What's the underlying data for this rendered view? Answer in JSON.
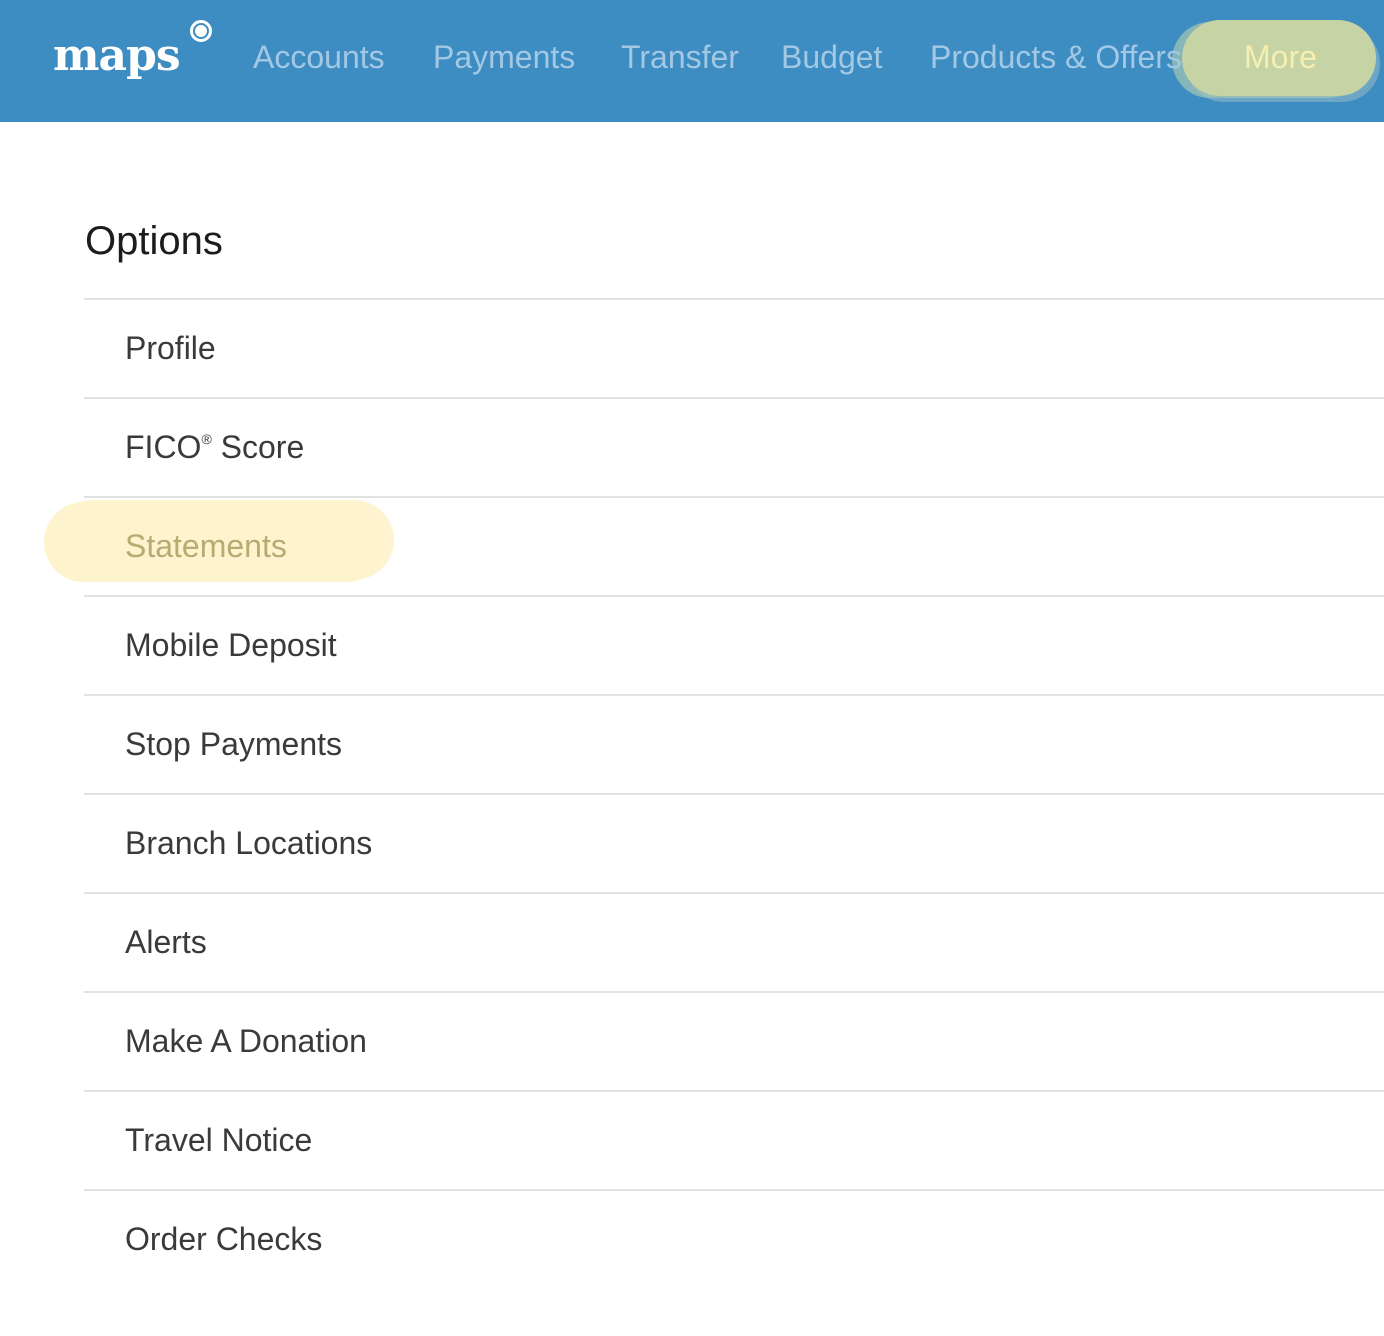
{
  "header": {
    "logo_text": "maps",
    "nav_items": [
      {
        "label": "Accounts"
      },
      {
        "label": "Payments"
      },
      {
        "label": "Transfer"
      },
      {
        "label": "Budget"
      },
      {
        "label": "Products & Offers"
      },
      {
        "label": "More"
      }
    ],
    "colors": {
      "bar": "#3d8cc2",
      "nav_text": "#a3c8e4",
      "highlight": "#c6d3a4"
    }
  },
  "main": {
    "title": "Options",
    "options": [
      {
        "label": "Profile"
      },
      {
        "label": "FICO",
        "sup": "®",
        "suffix": " Score"
      },
      {
        "label": "Statements"
      },
      {
        "label": "Mobile Deposit"
      },
      {
        "label": "Stop Payments"
      },
      {
        "label": "Branch Locations"
      },
      {
        "label": "Alerts"
      },
      {
        "label": "Make A Donation"
      },
      {
        "label": "Travel Notice"
      },
      {
        "label": "Order Checks"
      }
    ],
    "highlight_color": "#fdf4cd"
  }
}
